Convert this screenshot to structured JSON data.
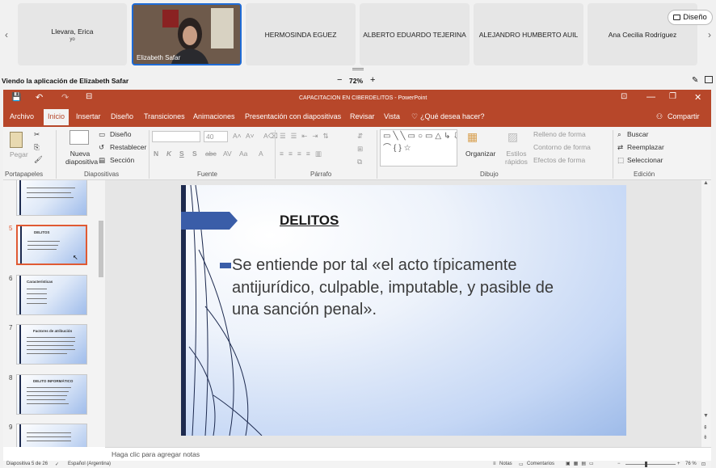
{
  "participants": [
    {
      "name": "Llevara, Erica",
      "sub": "yo"
    },
    {
      "name": "Elizabeth Safar"
    },
    {
      "name": "HERMOSINDA EGUEZ"
    },
    {
      "name": "ALBERTO EDUARDO TEJERINA"
    },
    {
      "name": "ALEJANDRO HUMBERTO AUIL"
    },
    {
      "name": "Ana Cecilia Rodríguez"
    }
  ],
  "strip": {
    "design_label": "Diseño",
    "prev_arrow": "‹",
    "next_arrow": "›"
  },
  "viewbar": {
    "viewing_label": "Viendo la aplicación de Elizabeth Safar",
    "zoom": "72%",
    "minus": "−",
    "plus": "+"
  },
  "app": {
    "title": "CAPACITACION EN CIBERDELITOS - PowerPoint",
    "tabs": [
      "Archivo",
      "Inicio",
      "Insertar",
      "Diseño",
      "Transiciones",
      "Animaciones",
      "Presentación con diapositivas",
      "Revisar",
      "Vista"
    ],
    "tell_me": "¿Qué desea hacer?",
    "share": "Compartir"
  },
  "ribbon": {
    "paste": "Pegar",
    "new_slide": "Nueva diapositiva",
    "layout": "Diseño",
    "reset": "Restablecer",
    "section": "Sección",
    "font_name": "",
    "font_size": "40",
    "arrange": "Organizar",
    "quick_styles": "Estilos rápidos",
    "shape_fill": "Relleno de forma",
    "shape_outline": "Contorno de forma",
    "shape_effects": "Efectos de forma",
    "find": "Buscar",
    "replace": "Reemplazar",
    "select": "Seleccionar",
    "groups": [
      "Portapapeles",
      "Diapositivas",
      "Fuente",
      "Párrafo",
      "Dibujo",
      "Edición"
    ],
    "font_buttons": [
      "N",
      "K",
      "S",
      "S",
      "abc"
    ]
  },
  "thumbnails": [
    {
      "num": "",
      "title": ""
    },
    {
      "num": "5",
      "title": "DELITOS"
    },
    {
      "num": "6",
      "title": "Características"
    },
    {
      "num": "7",
      "title": "Factores de atribución"
    },
    {
      "num": "8",
      "title": "DELITO INFORMÁTICO"
    },
    {
      "num": "9",
      "title": ""
    }
  ],
  "slide": {
    "title": "DELITOS",
    "body": "Se entiende por tal «el acto típicamente antijurídico, culpable, imputable, y pasible de una sanción penal»."
  },
  "notes_placeholder": "Haga clic para agregar notas",
  "status": {
    "slide_counter": "Diapositiva 5 de 26",
    "language": "Español (Argentina)",
    "notes": "Notas",
    "comments": "Comentarios",
    "zoom": "76 %"
  },
  "colors": {
    "accent": "#b7472a",
    "selection": "#e05a33",
    "video_border": "#1e6bd6"
  }
}
